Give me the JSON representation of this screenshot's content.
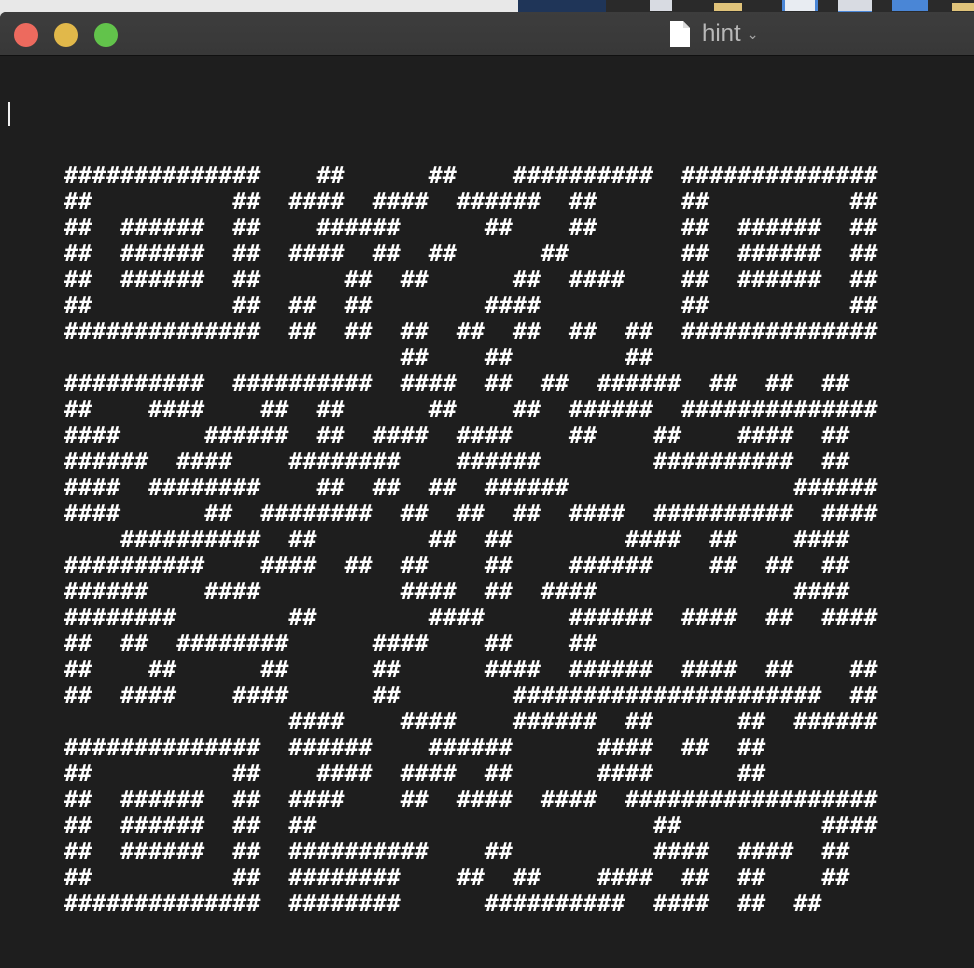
{
  "window": {
    "title": "hint",
    "title_icon": "document-icon",
    "traffic_lights": [
      "close",
      "minimize",
      "zoom"
    ]
  },
  "content": {
    "description": "QR code drawn as ASCII art using '##' for dark modules",
    "module_glyph": "##",
    "empty_glyph": "  ",
    "qr_rows": [
      "11111110010001001111101111111",
      "10000010110110111010001000001",
      "10111010011100010010001011101",
      "10111010110101000100001011101",
      "10111010001010001011001011101",
      "10000010101000011000001000001",
      "11111110101010101010101111111",
      "00000000000010010000100000000",
      "11111011111011010101110101010",
      "10011001010001001011101111111",
      "11000111010110110010010011010",
      "11101100111100111000011111010",
      "11011110010101011100000000111",
      "11000101111010101011011111011",
      "00111110100001010000110100110",
      "11111001101010010011100101010",
      "11100110000011010110000000110",
      "11110000100001100011101101011",
      "10101111000110010010000000000",
      "10010001000100011011101101001",
      "10110011000100001111111111101",
      "00000000110011001110100010111",
      "11111110111001110001101010000",
      "10000010011011010001100010000",
      "10111010110010110110111111111",
      "10111010100000000000010000011",
      "10111010111110010000011011010",
      "10000010111100101001101010010",
      "11111110111100011111011010100"
    ]
  }
}
